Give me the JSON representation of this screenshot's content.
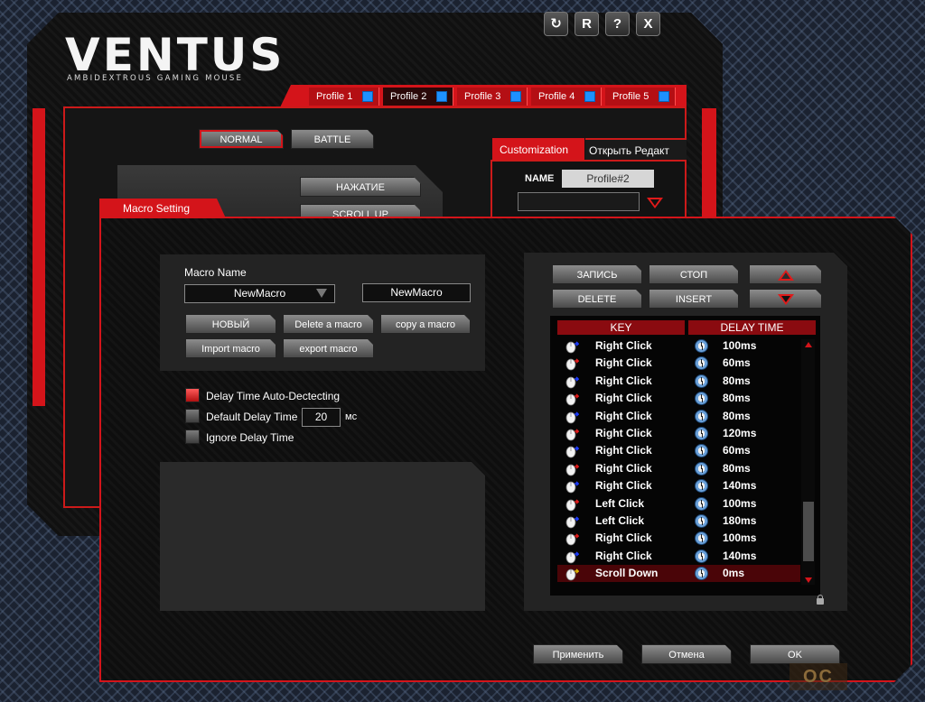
{
  "app": {
    "logo": "VENTUS",
    "logo_subtitle": "AMBIDEXTROUS GAMING MOUSE",
    "window_buttons": [
      "refresh-icon",
      "R",
      "?",
      "X"
    ]
  },
  "profiles": [
    {
      "label": "Profile 1"
    },
    {
      "label": "Profile 2",
      "active": true
    },
    {
      "label": "Profile 3"
    },
    {
      "label": "Profile 4"
    },
    {
      "label": "Profile 5"
    }
  ],
  "modes": {
    "normal": "NORMAL",
    "battle": "BATTLE"
  },
  "back_buttons": {
    "press": "НАЖАТИЕ",
    "scroll_up": "SCROLL UP"
  },
  "customization": {
    "tab_label": "Customization",
    "open_editor_label": "Открыть Редакт",
    "name_label": "NAME",
    "name_value": "Profile#2"
  },
  "macro": {
    "title": "Macro Setting",
    "name_label": "Macro Name",
    "selected_macro": "NewMacro",
    "macro_name_value": "NewMacro",
    "buttons": {
      "new": "НОВЫЙ",
      "delete_macro": "Delete a macro",
      "copy_macro": "copy a macro",
      "import_macro": "Import macro",
      "export_macro": "export macro"
    },
    "options": {
      "auto_detect": "Delay Time Auto-Dectecting",
      "default_delay": "Default Delay Time",
      "default_delay_value": "20",
      "default_delay_unit": "мс",
      "ignore_delay": "Ignore Delay Time"
    },
    "record": {
      "record": "ЗАПИСЬ",
      "stop": "СТОП",
      "delete": "DELETE",
      "insert": "INSERT"
    },
    "table": {
      "headers": {
        "key": "KEY",
        "delay": "DELAY TIME"
      },
      "rows": [
        {
          "key": "Right Click",
          "delay": "100ms",
          "mark": "#1e3cff"
        },
        {
          "key": "Right Click",
          "delay": "60ms",
          "mark": "#e01a1a"
        },
        {
          "key": "Right Click",
          "delay": "80ms",
          "mark": "#1e3cff"
        },
        {
          "key": "Right Click",
          "delay": "80ms",
          "mark": "#e01a1a"
        },
        {
          "key": "Right Click",
          "delay": "80ms",
          "mark": "#1e3cff"
        },
        {
          "key": "Right Click",
          "delay": "120ms",
          "mark": "#e01a1a"
        },
        {
          "key": "Right Click",
          "delay": "60ms",
          "mark": "#1e3cff"
        },
        {
          "key": "Right Click",
          "delay": "80ms",
          "mark": "#e01a1a"
        },
        {
          "key": "Right Click",
          "delay": "140ms",
          "mark": "#1e3cff"
        },
        {
          "key": "Left Click",
          "delay": "100ms",
          "mark": "#e01a1a"
        },
        {
          "key": "Left Click",
          "delay": "180ms",
          "mark": "#1e3cff"
        },
        {
          "key": "Right Click",
          "delay": "100ms",
          "mark": "#e01a1a"
        },
        {
          "key": "Right Click",
          "delay": "140ms",
          "mark": "#1e3cff"
        },
        {
          "key": "Scroll Down",
          "delay": "0ms",
          "mark": "#d8b000",
          "selected": true
        }
      ]
    },
    "footer": {
      "apply": "Применить",
      "cancel": "Отмена",
      "ok": "OK"
    }
  },
  "watermark": "OC",
  "colors": {
    "accent": "#d4141a",
    "profile_indicator": "#1e90ff"
  }
}
